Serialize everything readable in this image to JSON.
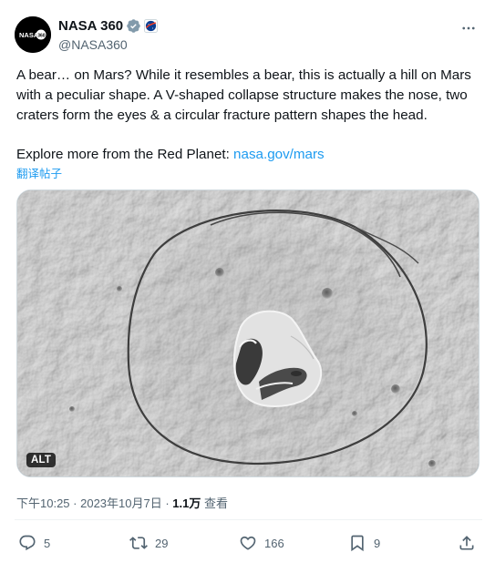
{
  "tweet": {
    "author": {
      "display_name": "NASA 360",
      "handle": "@NASA360",
      "avatar_icon": "nasa360-logo-icon",
      "verified_icon": "verified-badge-icon",
      "affiliate_icon": "nasa-affiliate-icon",
      "avatar_text": "NASA",
      "avatar_suffix": "360"
    },
    "more_icon": "more-options-icon",
    "text_paragraph_1": "A bear… on Mars? While it resembles a bear, this is actually a hill on Mars with a peculiar shape. A V-shaped collapse structure makes the nose, two craters form the eyes & a circular fracture pattern shapes the head.",
    "text_paragraph_2_prefix": "Explore more from the Red Planet: ",
    "text_paragraph_2_link": "nasa.gov/mars",
    "translate_label": "翻译帖子",
    "media": {
      "alt_badge": "ALT"
    },
    "meta": {
      "time": "下午10:25",
      "separator": " · ",
      "date": "2023年10月7日",
      "views_count": "1.1万",
      "views_label": " 查看"
    },
    "actions": {
      "reply": {
        "icon": "reply-icon",
        "count": "5"
      },
      "retweet": {
        "icon": "retweet-icon",
        "count": "29"
      },
      "like": {
        "icon": "heart-icon",
        "count": "166"
      },
      "bookmark": {
        "icon": "bookmark-icon",
        "count": "9"
      },
      "share": {
        "icon": "share-icon"
      }
    },
    "colors": {
      "link": "#1d9bf0",
      "text": "#0f1419",
      "secondary": "#536471",
      "verified": "#829aab"
    }
  }
}
